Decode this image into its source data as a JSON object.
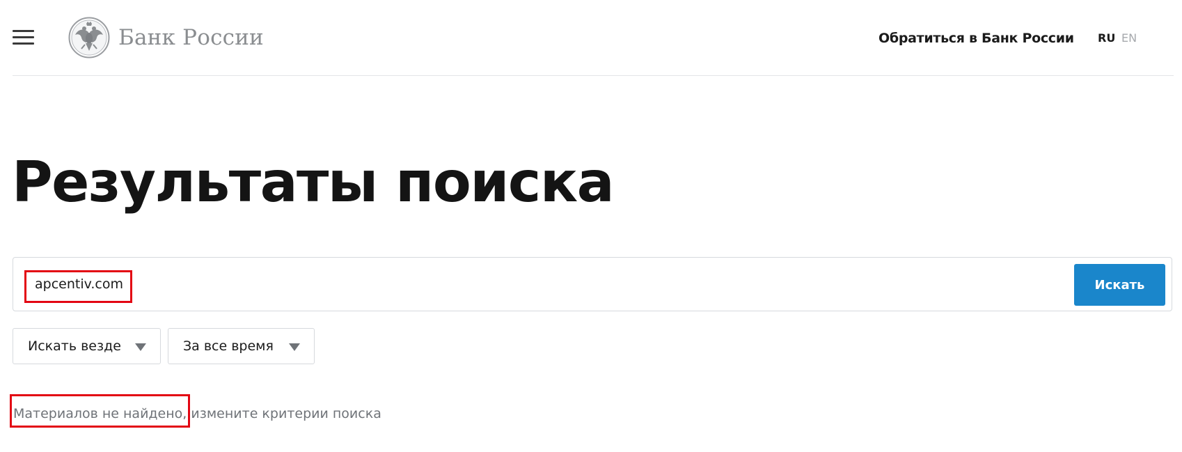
{
  "header": {
    "logo_text": "Банк России",
    "contact_link": "Обратиться в Банк России",
    "lang_ru": "RU",
    "lang_en": "EN"
  },
  "page": {
    "title": "Результаты поиска"
  },
  "search": {
    "query": "apcentiv.com",
    "button_label": "Искать"
  },
  "filters": {
    "scope_selected": "Искать везде",
    "period_selected": "За все время"
  },
  "results": {
    "not_found": "Материалов не найдено",
    "hint": "измените критерии поиска"
  },
  "colors": {
    "accent": "#1a86cb",
    "highlight": "#e30613",
    "muted_text": "#6f7378"
  },
  "icons": {
    "menu": "menu-icon",
    "logo": "double-headed-eagle-icon",
    "dropdown": "triangle-down-icon"
  }
}
